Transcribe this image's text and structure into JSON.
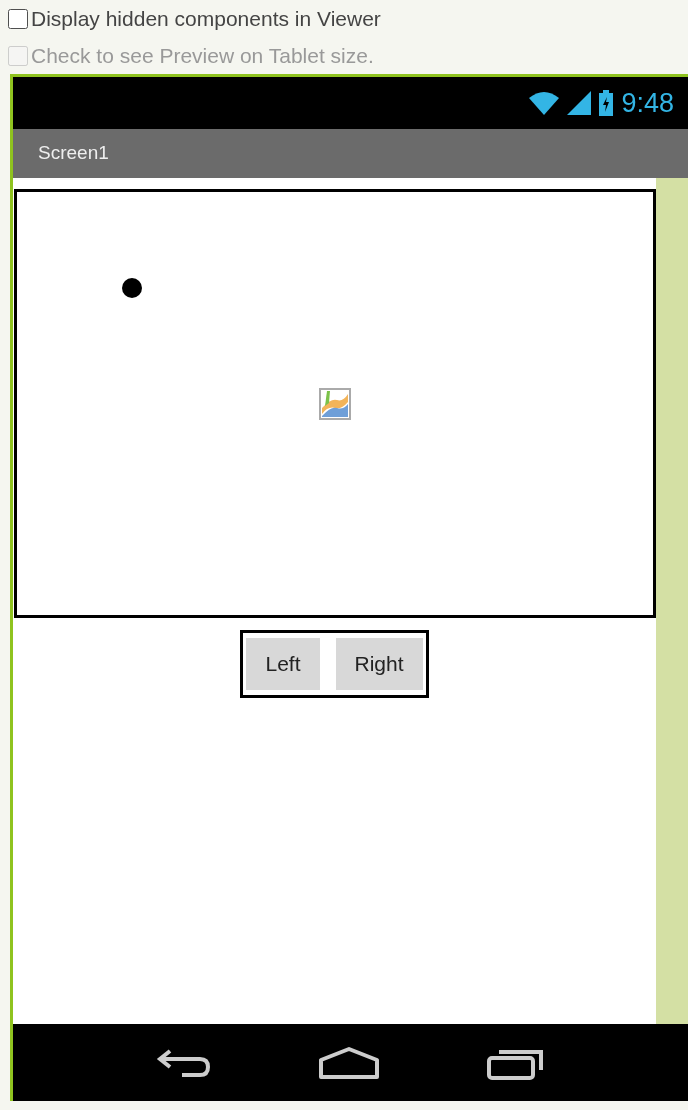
{
  "options": [
    {
      "label": "Display hidden components in Viewer",
      "checked": false,
      "disabled": false
    },
    {
      "label": "Check to see Preview on Tablet size.",
      "checked": false,
      "disabled": true
    }
  ],
  "status_bar": {
    "time": "9:48"
  },
  "title_bar": {
    "title": "Screen1"
  },
  "buttons": [
    "Left",
    "Right"
  ]
}
